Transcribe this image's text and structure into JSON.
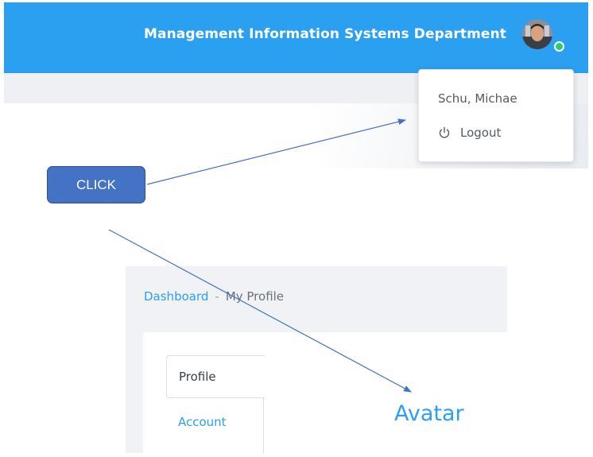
{
  "header": {
    "title": "Management Information Systems Department",
    "accent_color": "#2b9ff0"
  },
  "user_menu": {
    "user_name": "Schu, Michae",
    "logout_label": "Logout",
    "logout_icon": "power-icon",
    "status": "online"
  },
  "annotation": {
    "label": "CLICK",
    "color": "#4472c4"
  },
  "breadcrumb": {
    "root": "Dashboard",
    "separator": "-",
    "current": "My Profile"
  },
  "profile_tabs": {
    "profile_label": "Profile",
    "account_label": "Account"
  },
  "section": {
    "avatar_heading": "Avatar"
  }
}
